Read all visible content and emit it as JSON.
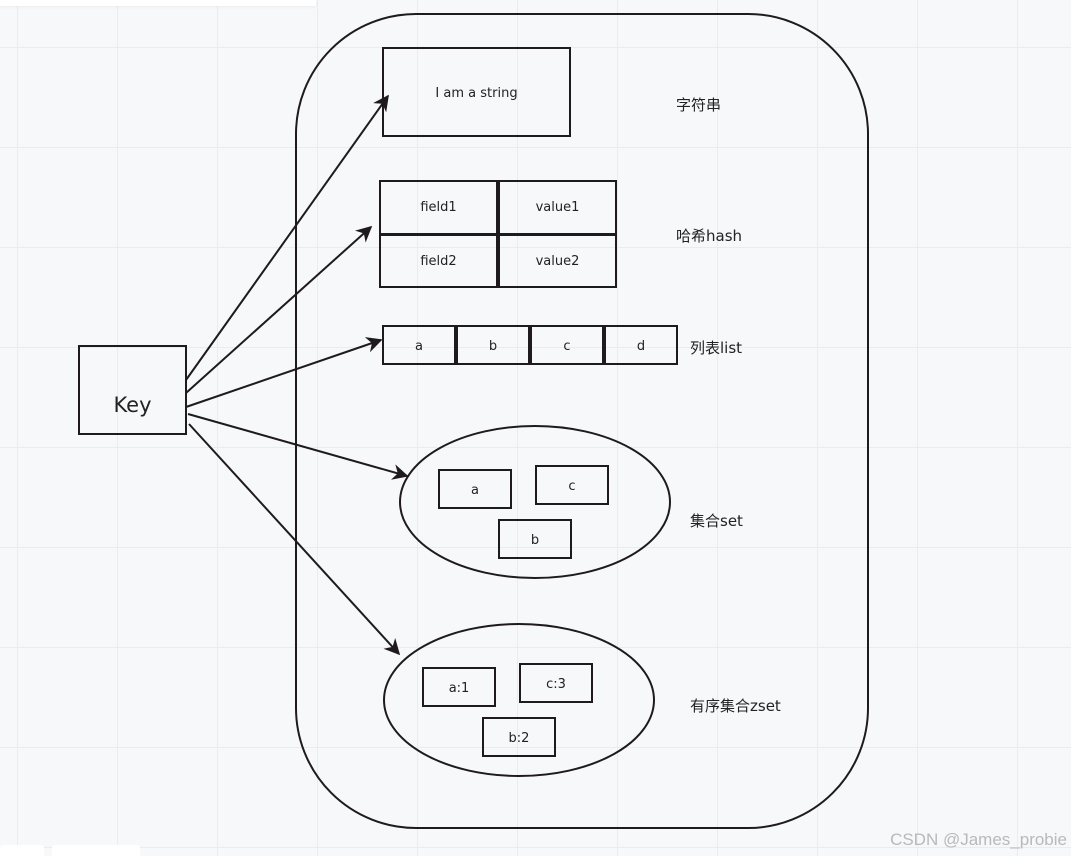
{
  "diagram": {
    "key": {
      "label": "Key"
    },
    "string": {
      "value": "I am a string",
      "type_label": "字符串"
    },
    "hash": {
      "type_label": "哈希hash",
      "entries": [
        {
          "field": "field1",
          "value": "value1"
        },
        {
          "field": "field2",
          "value": "value2"
        }
      ]
    },
    "list": {
      "type_label": "列表list",
      "items": [
        "a",
        "b",
        "c",
        "d"
      ]
    },
    "set": {
      "type_label": "集合set",
      "members": [
        "a",
        "c",
        "b"
      ]
    },
    "zset": {
      "type_label": "有序集合zset",
      "members": [
        "a:1",
        "c:3",
        "b:2"
      ]
    },
    "edges": [
      {
        "from": "Key",
        "to": "string"
      },
      {
        "from": "Key",
        "to": "hash"
      },
      {
        "from": "Key",
        "to": "list"
      },
      {
        "from": "Key",
        "to": "set"
      },
      {
        "from": "Key",
        "to": "zset"
      }
    ],
    "stroke_color": "#1f1a1c",
    "background_color": "#f7f8fa"
  },
  "watermark": "CSDN @James_probie"
}
